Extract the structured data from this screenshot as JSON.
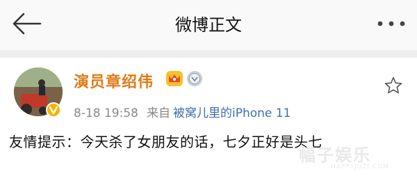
{
  "nav": {
    "title": "微博正文",
    "back_icon": "back-arrow-icon",
    "more_icon": "more-dots-icon"
  },
  "post": {
    "username": "演员章绍伟",
    "badges": [
      "crown-badge-icon",
      "medal-badge-icon"
    ],
    "verified_icon": "verified-v-icon",
    "time": "8-18 19:58",
    "source_prefix": "来自",
    "source": "被窝儿里的iPhone 11",
    "text": "友情提示：今天杀了女朋友的话，七夕正好是头七",
    "favorite_icon": "star-icon"
  },
  "watermark": {
    "text": "幅子娱乐",
    "sub": "HAPPYJUZI.COM"
  },
  "colors": {
    "username": "#e07a16",
    "source": "#3d6fad",
    "meta": "#888888",
    "divider": "#eeeeee"
  }
}
